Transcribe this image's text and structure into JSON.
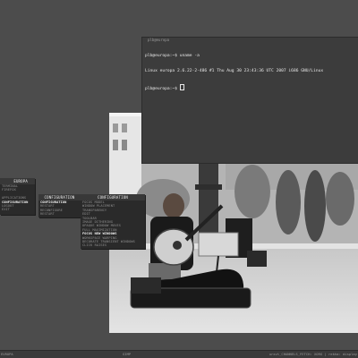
{
  "terminal": {
    "title": "plb@europa",
    "lines": [
      "plb@europa:~$ uname -a",
      "Linux europa 2.6.22-2-486 #1 Thu Aug 30 23:43:36 UTC 2007 i686 GNU/Linux",
      "plb@europa:~$ "
    ]
  },
  "root_menu": {
    "title": "EUROPA",
    "items": [
      "TERMINAL",
      "FIREFOX",
      "",
      "APPLICATIONS",
      "CONFIGURATION",
      "LOGOUT",
      "EXIT"
    ]
  },
  "config_menu": {
    "title": "CONFIGURATION",
    "items": [
      "CONFIGURATION",
      "RESTART",
      "RECONFIGURE",
      "RESTART"
    ]
  },
  "sub_menu": {
    "title": "CONFIGURATION",
    "items": [
      "FOCUS MODEL",
      "WINDOW PLACEMENT",
      "TRANSPARENCY",
      "EDIT",
      "TOOLBAR",
      "IMAGE DITHERING",
      "OPAQUE WINDOW MOVES",
      "FULL MAXIMIZATION",
      "FOCUS NEW WINDOWS",
      "WORKSPACE WARPING",
      "DECORATE TRANSIENT WINDOWS",
      "CLICK RAISES"
    ]
  },
  "panel": {
    "left": "EUROPA",
    "middle": "GIMP",
    "right": "urxvt_CHANNELS_FETCH: XORG | rekha: display"
  },
  "colors": {
    "desktop": "#4c4c4c",
    "menu_bg": "#2a2a2a",
    "terminal_bg": "#3c3c3c"
  }
}
